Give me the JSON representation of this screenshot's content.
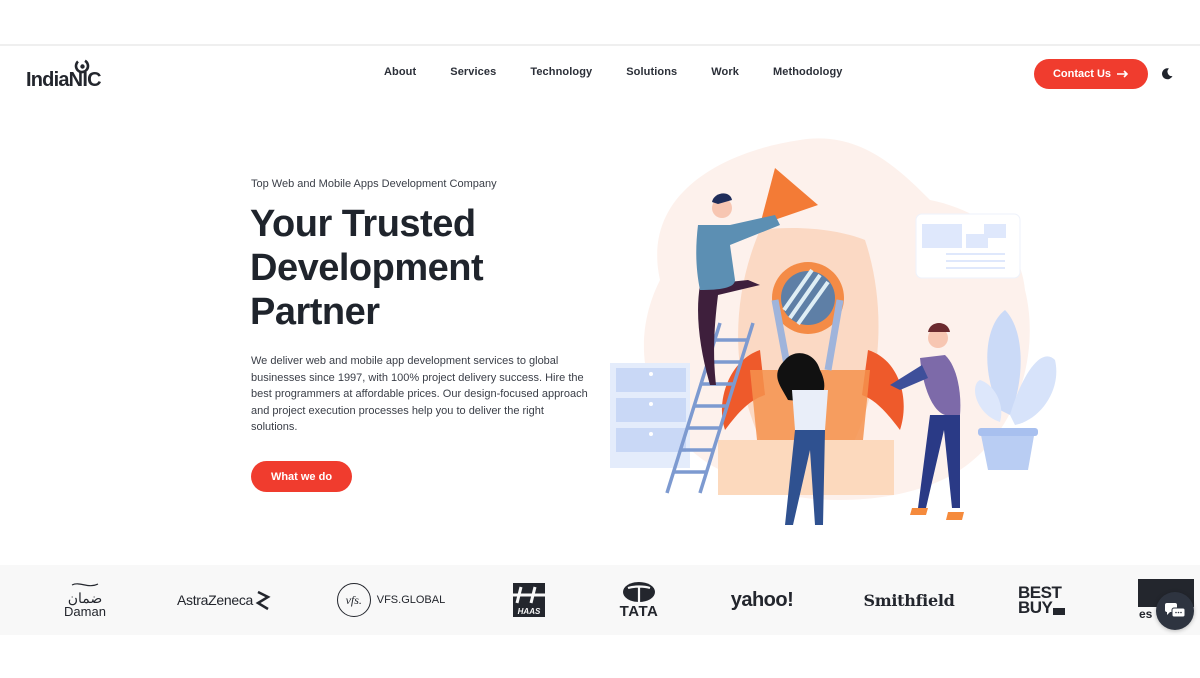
{
  "brand": {
    "name": "IndiaNIC",
    "accent_color": "#f03c2e",
    "text_color": "#1f242c"
  },
  "nav": {
    "items": [
      {
        "label": "About"
      },
      {
        "label": "Services"
      },
      {
        "label": "Technology"
      },
      {
        "label": "Solutions"
      },
      {
        "label": "Work"
      },
      {
        "label": "Methodology"
      }
    ],
    "contact_label": "Contact Us",
    "contact_icon": "arrow-right-icon",
    "theme_icon": "moon-icon"
  },
  "hero": {
    "eyebrow": "Top Web and Mobile Apps Development Company",
    "title_lines": [
      "Your Trusted",
      "Development",
      "Partner"
    ],
    "description": "We deliver web and mobile app development services to global businesses since 1997, with 100% project delivery success. Hire the best programmers at affordable prices. Our design-focused approach and project execution processes help you to deliver the right solutions.",
    "cta_label": "What we do",
    "illustration": "team-building-rocket-illustration"
  },
  "clients": {
    "logos": [
      {
        "name": "Daman",
        "arabic": "ضمان"
      },
      {
        "name": "AstraZeneca"
      },
      {
        "name": "VFS.GLOBAL",
        "mark": "vfs."
      },
      {
        "name": "HAAS"
      },
      {
        "name": "TATA"
      },
      {
        "name": "yahoo!"
      },
      {
        "name": "Smithfield"
      },
      {
        "name": "BEST BUY",
        "line1": "BEST",
        "line2": "BUY"
      },
      {
        "name": "es"
      }
    ]
  },
  "chat": {
    "icon": "chat-bubbles-icon"
  }
}
